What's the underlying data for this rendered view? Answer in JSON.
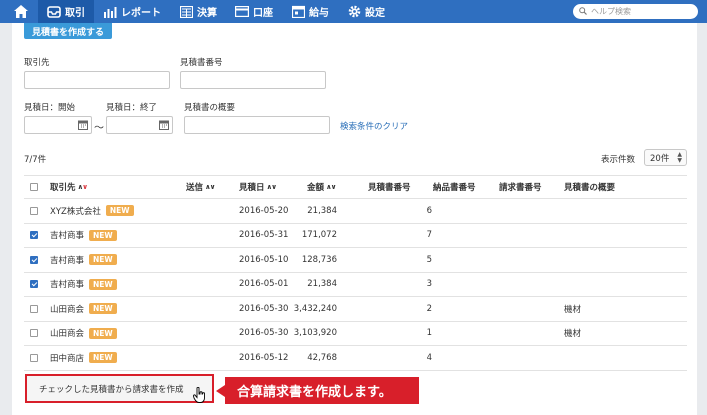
{
  "nav": {
    "items": [
      {
        "label": "",
        "icon": "home-icon"
      },
      {
        "label": "取引",
        "icon": "tray-icon"
      },
      {
        "label": "レポート",
        "icon": "chart-icon"
      },
      {
        "label": "決算",
        "icon": "calculator-icon"
      },
      {
        "label": "口座",
        "icon": "wallet-icon"
      },
      {
        "label": "給与",
        "icon": "calendar-icon"
      },
      {
        "label": "設定",
        "icon": "gear-icon"
      }
    ],
    "search_placeholder": "ヘルプ検索"
  },
  "create_button": "見積書を作成する",
  "filters": {
    "partner_label": "取引先",
    "quote_number_label": "見積書番号",
    "start_date_label": "見積日：開始",
    "end_date_label": "見積日：終了",
    "tilde": "〜",
    "summary_label": "見積書の概要",
    "clear_link": "検索条件のクリア"
  },
  "result_count": "7/7件",
  "per_page": {
    "label": "表示件数",
    "value": "20件"
  },
  "table": {
    "headers": {
      "partner": "取引先",
      "sent": "送信",
      "date": "見積日",
      "amount": "金額",
      "quote_no": "見積書番号",
      "delivery_no": "納品書番号",
      "invoice_no": "請求書番号",
      "summary": "見積書の概要"
    },
    "rows": [
      {
        "checked": false,
        "partner": "XYZ株式会社",
        "badge": "NEW",
        "date": "2016-05-20",
        "amount": "21,384",
        "quote_no": "6",
        "summary": ""
      },
      {
        "checked": true,
        "partner": "吉村商事",
        "badge": "NEW",
        "date": "2016-05-31",
        "amount": "171,072",
        "quote_no": "7",
        "summary": ""
      },
      {
        "checked": true,
        "partner": "吉村商事",
        "badge": "NEW",
        "date": "2016-05-10",
        "amount": "128,736",
        "quote_no": "5",
        "summary": ""
      },
      {
        "checked": true,
        "partner": "吉村商事",
        "badge": "NEW",
        "date": "2016-05-01",
        "amount": "21,384",
        "quote_no": "3",
        "summary": ""
      },
      {
        "checked": false,
        "partner": "山田商会",
        "badge": "NEW",
        "date": "2016-05-30",
        "amount": "3,432,240",
        "quote_no": "2",
        "summary": "機材"
      },
      {
        "checked": false,
        "partner": "山田商会",
        "badge": "NEW",
        "date": "2016-05-30",
        "amount": "3,103,920",
        "quote_no": "1",
        "summary": "機材"
      },
      {
        "checked": false,
        "partner": "田中商店",
        "badge": "NEW",
        "date": "2016-05-12",
        "amount": "42,768",
        "quote_no": "4",
        "summary": ""
      }
    ]
  },
  "bottom_button": "チェックした見積書から請求書を作成",
  "callout": "合算請求書を作成します。",
  "colors": {
    "nav": "#2f6fc0",
    "accent": "#3a9ad9",
    "badge": "#f0ad4e",
    "highlight": "#d81f2a"
  }
}
